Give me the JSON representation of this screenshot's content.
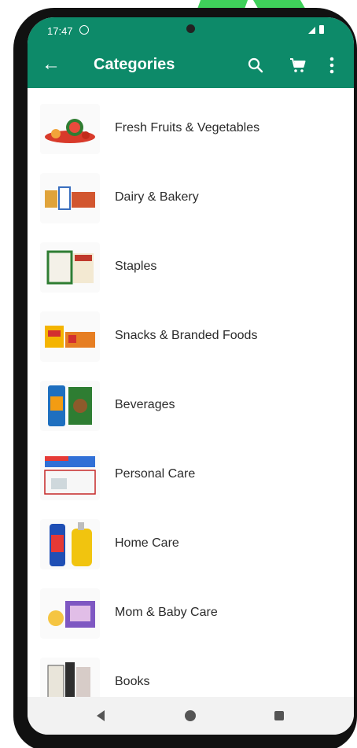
{
  "status_bar": {
    "time": "17:47",
    "icons": [
      "whatsapp-icon",
      "camera-icon",
      "signal-icon",
      "battery-icon"
    ]
  },
  "app_bar": {
    "title": "Categories",
    "color": "#0d8a69",
    "icons": [
      "back-arrow-icon",
      "search-icon",
      "cart-icon",
      "more-vert-icon"
    ]
  },
  "categories": [
    {
      "label": "Fresh Fruits & Vegetables",
      "thumbnail": "fruits-vegetables-image"
    },
    {
      "label": "Dairy & Bakery",
      "thumbnail": "dairy-bakery-image"
    },
    {
      "label": "Staples",
      "thumbnail": "staples-image"
    },
    {
      "label": "Snacks & Branded Foods",
      "thumbnail": "snacks-image"
    },
    {
      "label": "Beverages",
      "thumbnail": "beverages-image"
    },
    {
      "label": "Personal Care",
      "thumbnail": "personal-care-image"
    },
    {
      "label": "Home Care",
      "thumbnail": "home-care-image"
    },
    {
      "label": "Mom & Baby Care",
      "thumbnail": "mom-baby-image"
    },
    {
      "label": "Books",
      "thumbnail": "books-image"
    }
  ],
  "nav_bar": {
    "icons": [
      "nav-back-icon",
      "nav-home-icon",
      "nav-recent-icon"
    ]
  }
}
